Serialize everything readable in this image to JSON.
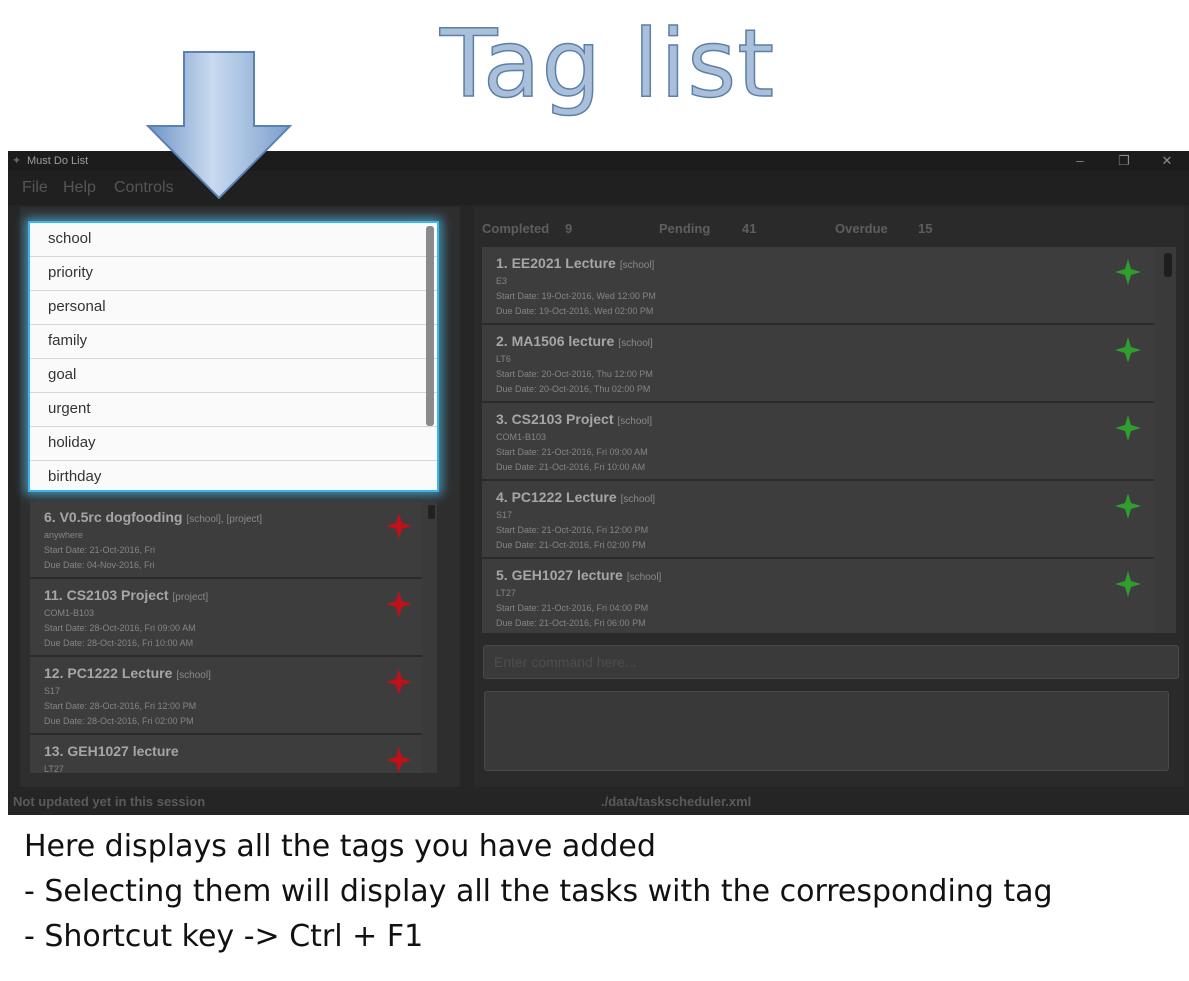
{
  "slide": {
    "heading": "Tag list",
    "notes": [
      "Here displays all the tags you have added",
      "- Selecting them will display all the tasks with the corresponding tag",
      "- Shortcut key -> Ctrl + F1"
    ]
  },
  "window": {
    "title": "Must Do List",
    "controls": {
      "minimize": "–",
      "restore": "❐",
      "close": "✕"
    }
  },
  "menu": {
    "file": "File",
    "help": "Help",
    "controls": "Controls"
  },
  "tags": [
    "school",
    "priority",
    "personal",
    "family",
    "goal",
    "urgent",
    "holiday",
    "birthday"
  ],
  "filtered_tasks": [
    {
      "name": "6. V0.5rc dogfooding",
      "tags": "[school], [project]",
      "venue": "anywhere",
      "start": "Start Date: 21-Oct-2016, Fri",
      "due": "Due Date: 04-Nov-2016, Fri",
      "star": "red-star-icon"
    },
    {
      "name": "11. CS2103 Project",
      "tags": "[project]",
      "venue": "COM1-B103",
      "start": "Start Date: 28-Oct-2016, Fri 09:00 AM",
      "due": "Due Date: 28-Oct-2016, Fri 10:00 AM",
      "star": "red-star-icon"
    },
    {
      "name": "12. PC1222 Lecture",
      "tags": "[school]",
      "venue": "S17",
      "start": "Start Date: 28-Oct-2016, Fri 12:00 PM",
      "due": "Due Date: 28-Oct-2016, Fri 02:00 PM",
      "star": "red-star-icon"
    },
    {
      "name": "13. GEH1027 lecture",
      "tags": "",
      "venue": "LT27",
      "start": "",
      "due": "",
      "star": "red-star-icon"
    }
  ],
  "stats": {
    "completed_label": "Completed",
    "completed": "9",
    "pending_label": "Pending",
    "pending": "41",
    "overdue_label": "Overdue",
    "overdue": "15"
  },
  "tasks": [
    {
      "name": "1. EE2021 Lecture",
      "tags": "[school]",
      "venue": "E3",
      "start": "Start Date: 19-Oct-2016, Wed 12:00 PM",
      "due": "Due Date: 19-Oct-2016, Wed 02:00 PM",
      "star": "green-star-icon"
    },
    {
      "name": "2. MA1506 lecture",
      "tags": "[school]",
      "venue": "LT6",
      "start": "Start Date: 20-Oct-2016, Thu 12:00 PM",
      "due": "Due Date: 20-Oct-2016, Thu 02:00 PM",
      "star": "green-star-icon"
    },
    {
      "name": "3. CS2103 Project",
      "tags": "[school]",
      "venue": "COM1-B103",
      "start": "Start Date: 21-Oct-2016, Fri 09:00 AM",
      "due": "Due Date: 21-Oct-2016, Fri 10:00 AM",
      "star": "green-star-icon"
    },
    {
      "name": "4. PC1222 Lecture",
      "tags": "[school]",
      "venue": "S17",
      "start": "Start Date: 21-Oct-2016, Fri 12:00 PM",
      "due": "Due Date: 21-Oct-2016, Fri 02:00 PM",
      "star": "green-star-icon"
    },
    {
      "name": "5. GEH1027 lecture",
      "tags": "[school]",
      "venue": "LT27",
      "start": "Start Date: 21-Oct-2016, Fri 04:00 PM",
      "due": "Due Date: 21-Oct-2016, Fri 06:00 PM",
      "star": "green-star-icon"
    }
  ],
  "command": {
    "placeholder": "Enter command here..."
  },
  "status": {
    "sync": "Not updated yet in this session",
    "file": "./data/taskscheduler.xml"
  },
  "colors": {
    "accent": "#3bb6ea",
    "red_star": "#c0101a",
    "green_star": "#2f9e2f"
  }
}
